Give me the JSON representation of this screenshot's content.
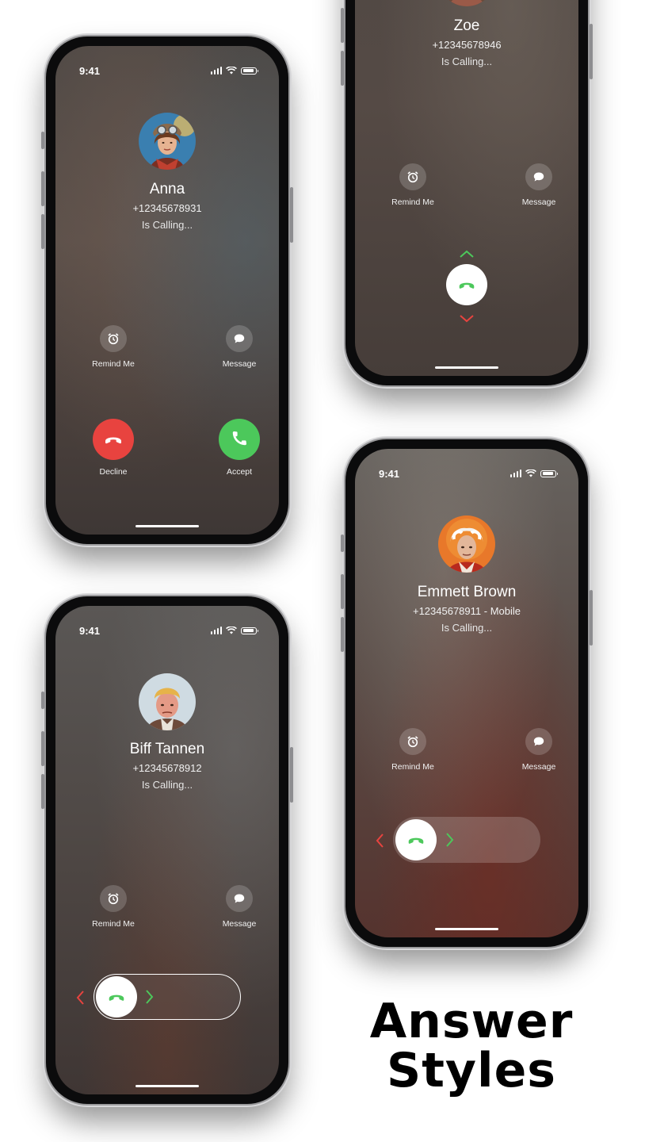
{
  "status_bar": {
    "time": "9:41"
  },
  "colors": {
    "accept": "#4cc85b",
    "decline": "#e8433f",
    "bg_page": "#ffffff"
  },
  "icons": {
    "remind": "alarm-clock-icon",
    "message": "speech-bubble-icon",
    "accept": "phone-handset-icon",
    "decline": "hang-up-icon",
    "swipe_up": "chevron-up-icon",
    "swipe_down": "chevron-down-icon",
    "swipe_left": "chevron-left-icon",
    "swipe_right": "chevron-right-icon"
  },
  "phones": [
    {
      "id": "anna",
      "caller_name": "Anna",
      "number": "+12345678931",
      "status": "Is Calling...",
      "actions": {
        "remind": "Remind Me",
        "message": "Message",
        "decline": "Decline",
        "accept": "Accept"
      },
      "answer_style": "buttons"
    },
    {
      "id": "zoe",
      "caller_name": "Zoe",
      "number": "+12345678946",
      "status": "Is Calling...",
      "actions": {
        "remind": "Remind Me",
        "message": "Message"
      },
      "answer_style": "vertical-swipe"
    },
    {
      "id": "emmett",
      "caller_name": "Emmett Brown",
      "number": "+12345678911 - Mobile",
      "status": "Is Calling...",
      "actions": {
        "remind": "Remind Me",
        "message": "Message"
      },
      "answer_style": "slider"
    },
    {
      "id": "biff",
      "caller_name": "Biff Tannen",
      "number": "+12345678912",
      "status": "Is Calling...",
      "actions": {
        "remind": "Remind Me",
        "message": "Message"
      },
      "answer_style": "slider-outlined"
    }
  ],
  "headline": {
    "line1": "Answer",
    "line2": "Styles"
  }
}
